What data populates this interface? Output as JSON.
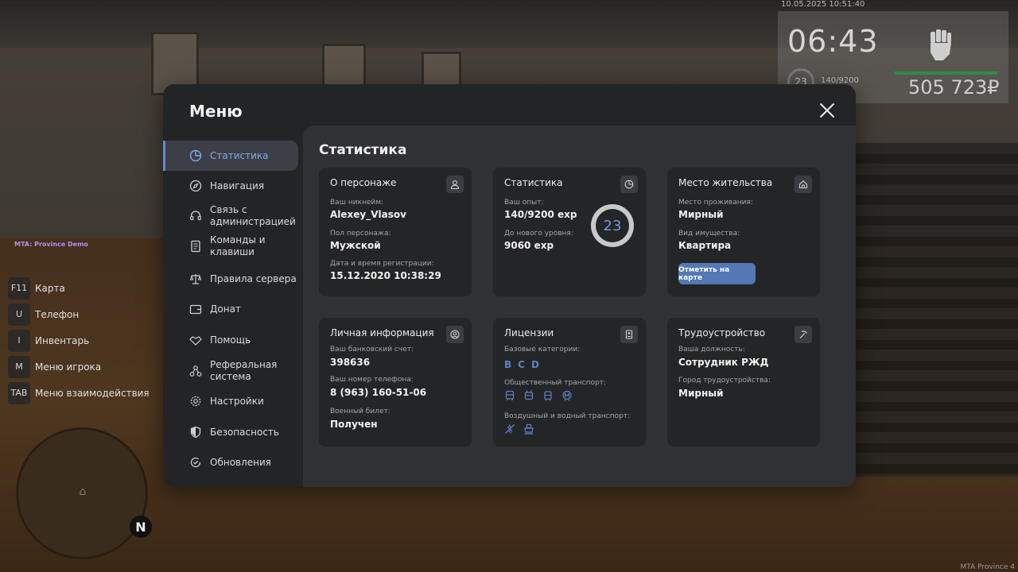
{
  "hud": {
    "datetime": "10.05.2025 10:51:40",
    "clock": "06:43",
    "level": "23",
    "exp": "140/9200",
    "money": "505 723₽"
  },
  "server_tag": "MTA: Province Demo",
  "binds": [
    {
      "key": "F11",
      "label": "Карта"
    },
    {
      "key": "U",
      "label": "Телефон"
    },
    {
      "key": "I",
      "label": "Инвентарь"
    },
    {
      "key": "M",
      "label": "Меню игрока"
    },
    {
      "key": "TAB",
      "label": "Меню взаимодействия"
    }
  ],
  "minimap": {
    "north": "N"
  },
  "watermark": "MTA Province 4",
  "menu": {
    "title": "Меню",
    "nav": [
      {
        "label": "Статистика",
        "icon": "pie-chart-icon",
        "active": true
      },
      {
        "label": "Навигация",
        "icon": "compass-icon"
      },
      {
        "label": "Связь с администрацией",
        "icon": "headset-icon"
      },
      {
        "label": "Команды и клавиши",
        "icon": "document-icon"
      },
      {
        "label": "Правила сервера",
        "icon": "scales-icon"
      },
      {
        "label": "Донат",
        "icon": "wallet-icon"
      },
      {
        "label": "Помощь",
        "icon": "handshake-icon"
      },
      {
        "label": "Реферальная система",
        "icon": "network-icon"
      },
      {
        "label": "Настройки",
        "icon": "gear-icon"
      },
      {
        "label": "Безопасность",
        "icon": "shield-icon"
      },
      {
        "label": "Обновления",
        "icon": "refresh-check-icon"
      }
    ]
  },
  "content": {
    "title": "Статистика",
    "character": {
      "title": "О персонаже",
      "nickname_label": "Ваш никнейм:",
      "nickname": "Alexey_Vlasov",
      "gender_label": "Пол персонажа:",
      "gender": "Мужской",
      "reg_label": "Дата и время регистрации:",
      "reg": "15.12.2020 10:38:29"
    },
    "stats": {
      "title": "Статистика",
      "exp_label": "Ваш опыт:",
      "exp": "140/9200 exp",
      "next_label": "До нового уровня:",
      "next": "9060 exp",
      "level": "23",
      "progress": 0.015
    },
    "residence": {
      "title": "Место жительства",
      "place_label": "Место проживания:",
      "place": "Мирный",
      "type_label": "Вид имущества:",
      "type": "Квартира",
      "button": "Отметить на карте"
    },
    "personal": {
      "title": "Личная информация",
      "bank_label": "Ваш банковский счет:",
      "bank": "398636",
      "phone_label": "Ваш номер телефона:",
      "phone": "8 (963) 160-51-06",
      "military_label": "Военный билет:",
      "military": "Получен"
    },
    "licenses": {
      "title": "Лицензии",
      "base_label": "Базовые категории:",
      "categories": [
        "B",
        "C",
        "D"
      ],
      "public_label": "Общественный транспорт:",
      "public_icons": [
        "bus-icon",
        "trolleybus-icon",
        "tram-icon",
        "metro-icon"
      ],
      "air_label": "Воздушный и водный транспорт:",
      "air_icons": [
        "plane-icon",
        "boat-icon"
      ],
      "accent": "#5b83c9"
    },
    "employment": {
      "title": "Трудоустройство",
      "position_label": "Ваша должность:",
      "position": "Сотрудник РЖД",
      "city_label": "Город трудоустройства:",
      "city": "Мирный"
    }
  },
  "colors": {
    "accent": "#5b8bd9",
    "button": "#5478b3",
    "modal_bg": "#232426",
    "content_bg": "#303134",
    "card_bg": "#242527"
  }
}
